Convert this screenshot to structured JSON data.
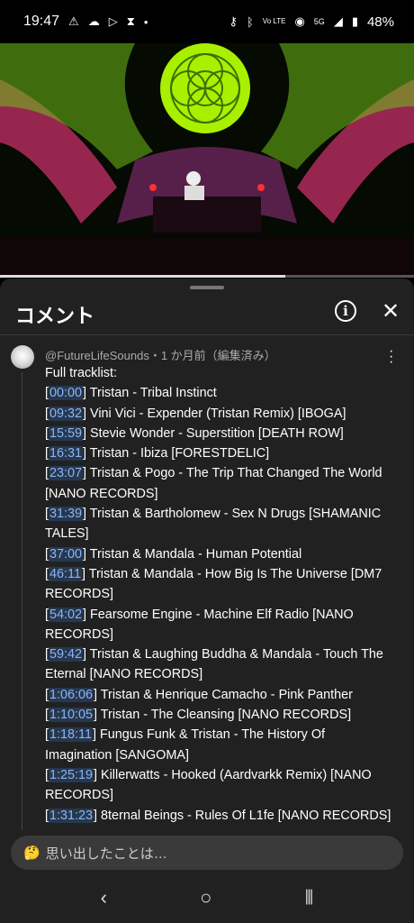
{
  "status_bar": {
    "time": "19:47",
    "battery": "48%",
    "network": "5G",
    "volte": "Vo LTE",
    "notification_icons": [
      "warning-icon",
      "cloud-icon",
      "play-store-icon",
      "hourglass-icon",
      "dot-icon"
    ],
    "system_icons": [
      "key-icon",
      "bluetooth-icon",
      "volte-icon",
      "hotspot-icon",
      "signal-icon",
      "battery-icon"
    ]
  },
  "video": {
    "progress_fraction": 0.69
  },
  "sheet": {
    "title": "コメント"
  },
  "comment": {
    "meta": "@FutureLifeSounds・1 か月前（編集済み）",
    "intro": "Full tracklist:",
    "tracks": [
      {
        "time": "00:00",
        "text": "Tristan - Tribal Instinct"
      },
      {
        "time": "09:32",
        "text": "Vini Vici - Expender (Tristan Remix) [IBOGA]"
      },
      {
        "time": "15:59",
        "text": "Stevie Wonder - Superstition [DEATH ROW]"
      },
      {
        "time": "16:31",
        "text": "Tristan - Ibiza [FORESTDELIC]"
      },
      {
        "time": "23:07",
        "text": "Tristan & Pogo - The Trip That Changed The World [NANO RECORDS]"
      },
      {
        "time": "31:39",
        "text": "Tristan & Bartholomew - Sex N Drugs [SHAMANIC TALES]"
      },
      {
        "time": "37:00",
        "text": "Tristan & Mandala - Human Potential"
      },
      {
        "time": "46:11",
        "text": "Tristan & Mandala - How Big Is The Universe [DM7 RECORDS]"
      },
      {
        "time": "54:02",
        "text": "Fearsome Engine - Machine Elf Radio [NANO RECORDS]"
      },
      {
        "time": "59:42",
        "text": "Tristan & Laughing Buddha & Mandala - Touch The Eternal [NANO RECORDS]"
      },
      {
        "time": "1:06:06",
        "text": "Tristan & Henrique Camacho - Pink Panther"
      },
      {
        "time": "1:10:05",
        "text": "Tristan - The Cleansing [NANO RECORDS]"
      },
      {
        "time": "1:18:11",
        "text": "Fungus Funk & Tristan - The History Of Imagination [SANGOMA]"
      },
      {
        "time": "1:25:19",
        "text": "Killerwatts - Hooked (Aardvarkk Remix) [NANO RECORDS]"
      },
      {
        "time": "1:31:23",
        "text": "8ternal Beings - Rules Of L1fe [NANO RECORDS]"
      }
    ]
  },
  "input": {
    "emoji": "🤔",
    "placeholder": "思い出したことは…"
  },
  "colors": {
    "sheet_bg": "#212121",
    "timestamp_bg": "#263850",
    "timestamp_fg": "#8cb4f2",
    "meta": "#aaaaaa"
  }
}
